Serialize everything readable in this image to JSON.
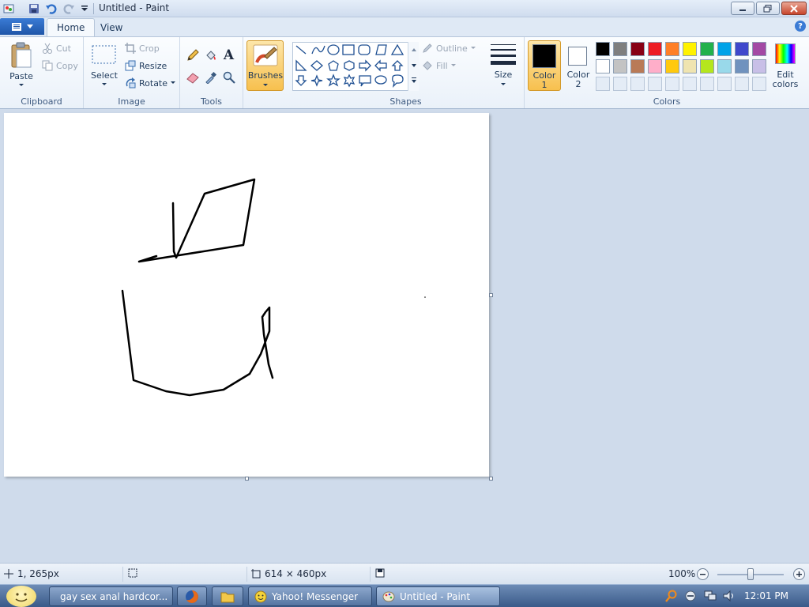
{
  "window": {
    "title": "Untitled - Paint"
  },
  "tabs": [
    {
      "label": "Home"
    },
    {
      "label": "View"
    }
  ],
  "ribbon": {
    "clipboard": {
      "group_label": "Clipboard",
      "paste": "Paste",
      "cut": "Cut",
      "copy": "Copy"
    },
    "image": {
      "group_label": "Image",
      "select": "Select",
      "crop": "Crop",
      "resize": "Resize",
      "rotate": "Rotate"
    },
    "tools": {
      "group_label": "Tools",
      "items": [
        "pencil-icon",
        "fill-bucket-icon",
        "text-icon",
        "eraser-icon",
        "color-picker-icon",
        "magnifier-icon"
      ]
    },
    "brushes": {
      "label": "Brushes"
    },
    "shapes": {
      "group_label": "Shapes",
      "outline": "Outline",
      "fill": "Fill"
    },
    "size": {
      "label": "Size"
    },
    "colors": {
      "group_label": "Colors",
      "color1": "Color",
      "color1_num": "1",
      "color2": "Color",
      "color2_num": "2",
      "edit_colors_line1": "Edit",
      "edit_colors_line2": "colors",
      "color1_value": "#000000",
      "color2_value": "#ffffff",
      "palette_row1": [
        "#000000",
        "#7f7f7f",
        "#880015",
        "#ed1c24",
        "#ff7f27",
        "#fff200",
        "#22b14c",
        "#00a2e8",
        "#3f48cc",
        "#a349a4"
      ],
      "palette_row2": [
        "#ffffff",
        "#c3c3c3",
        "#b97a57",
        "#ffaec9",
        "#ffc90e",
        "#efe4b0",
        "#b5e61d",
        "#99d9ea",
        "#7092be",
        "#c8bfe7"
      ]
    }
  },
  "status": {
    "cursor_position": "1, 265px",
    "canvas_size": "614 × 460px",
    "zoom": "100%"
  },
  "taskbar": {
    "items": [
      {
        "label": "gay sex anal hardcor..."
      },
      {
        "label": "Yahoo! Messenger"
      },
      {
        "label": "Untitled - Paint"
      }
    ],
    "clock": "12:01 PM"
  }
}
